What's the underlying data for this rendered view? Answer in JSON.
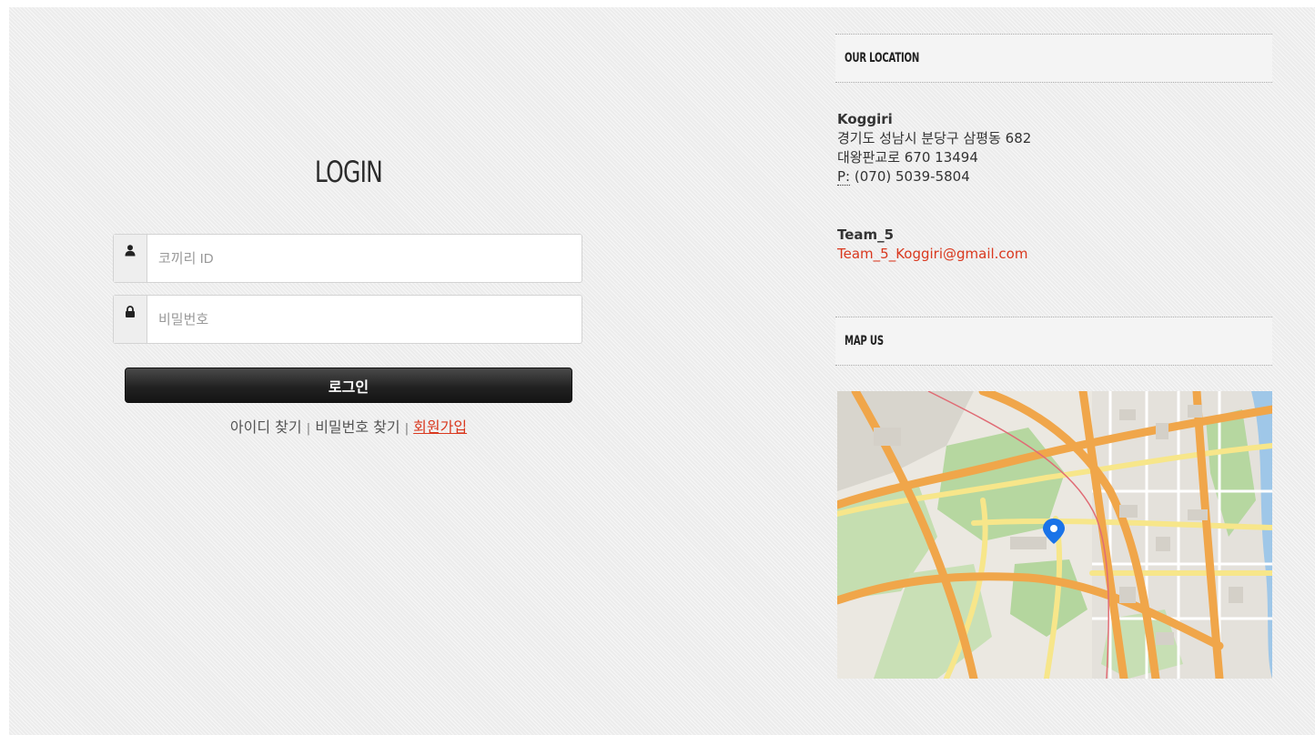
{
  "login": {
    "title": "LOGIN",
    "id_placeholder": "코끼리 ID",
    "password_placeholder": "비밀번호",
    "submit_label": "로그인",
    "find_id_label": "아이디 찾기",
    "find_password_label": "비밀번호 찾기",
    "signup_label": "회원가입",
    "separator": "|",
    "id_icon": "user-icon",
    "password_icon": "lock-icon"
  },
  "location": {
    "header": "OUR LOCATION",
    "company": "Koggiri",
    "address_line1": "경기도 성남시 분당구 삼평동 682",
    "address_line2": "대왕판교로 670 13494",
    "phone_label": "P:",
    "phone": "(070) 5039-5804"
  },
  "team": {
    "name": "Team_5",
    "email": "Team_5_Koggiri@gmail.com"
  },
  "map": {
    "header": "MAP US",
    "marker_icon": "map-pin-icon"
  },
  "colors": {
    "accent": "#d9381e",
    "button_dark": "#222222",
    "map_road_major": "#f0a64a",
    "map_road_minor": "#f7e68a",
    "map_park": "#b6d7a0",
    "map_water": "#9fc7e8",
    "marker": "#1a73e8"
  }
}
